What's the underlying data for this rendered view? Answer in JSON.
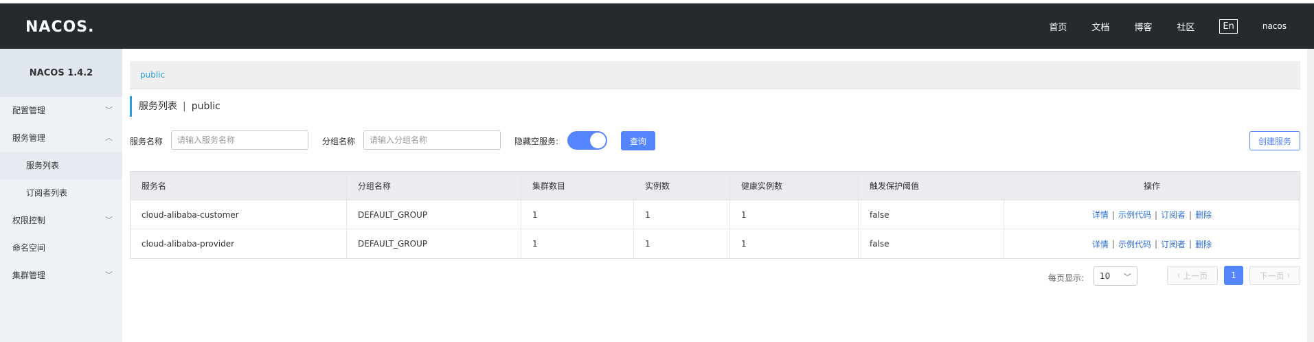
{
  "header": {
    "logo": "NACOS.",
    "nav": [
      "首页",
      "文档",
      "博客",
      "社区"
    ],
    "lang": "En",
    "user": "nacos"
  },
  "sidebar": {
    "version": "NACOS 1.4.2",
    "items": [
      {
        "label": "配置管理"
      },
      {
        "label": "服务管理"
      },
      {
        "label": "服务列表"
      },
      {
        "label": "订阅者列表"
      },
      {
        "label": "权限控制"
      },
      {
        "label": "命名空间"
      },
      {
        "label": "集群管理"
      }
    ]
  },
  "namespace": {
    "link": "public"
  },
  "page_title": {
    "title": "服务列表",
    "separator": "|",
    "namespace": "public"
  },
  "filters": {
    "service_name_label": "服务名称",
    "service_name_placeholder": "请输入服务名称",
    "group_name_label": "分组名称",
    "group_name_placeholder": "请输入分组名称",
    "hide_empty_label": "隐藏空服务:",
    "query_button": "查询",
    "create_button": "创建服务"
  },
  "table": {
    "headers": [
      "服务名",
      "分组名称",
      "集群数目",
      "实例数",
      "健康实例数",
      "触发保护阈值",
      "操作"
    ],
    "rows": [
      {
        "name": "cloud-alibaba-customer",
        "group": "DEFAULT_GROUP",
        "clusters": "1",
        "instances": "1",
        "healthy": "1",
        "threshold": "false"
      },
      {
        "name": "cloud-alibaba-provider",
        "group": "DEFAULT_GROUP",
        "clusters": "1",
        "instances": "1",
        "healthy": "1",
        "threshold": "false"
      }
    ],
    "ops": {
      "detail": "详情",
      "sample": "示例代码",
      "subscriber": "订阅者",
      "delete": "删除",
      "sep": "|"
    }
  },
  "pagination": {
    "page_size_label": "每页显示:",
    "page_size": "10",
    "prev": "上一页",
    "current": "1",
    "next": "下一页"
  }
}
